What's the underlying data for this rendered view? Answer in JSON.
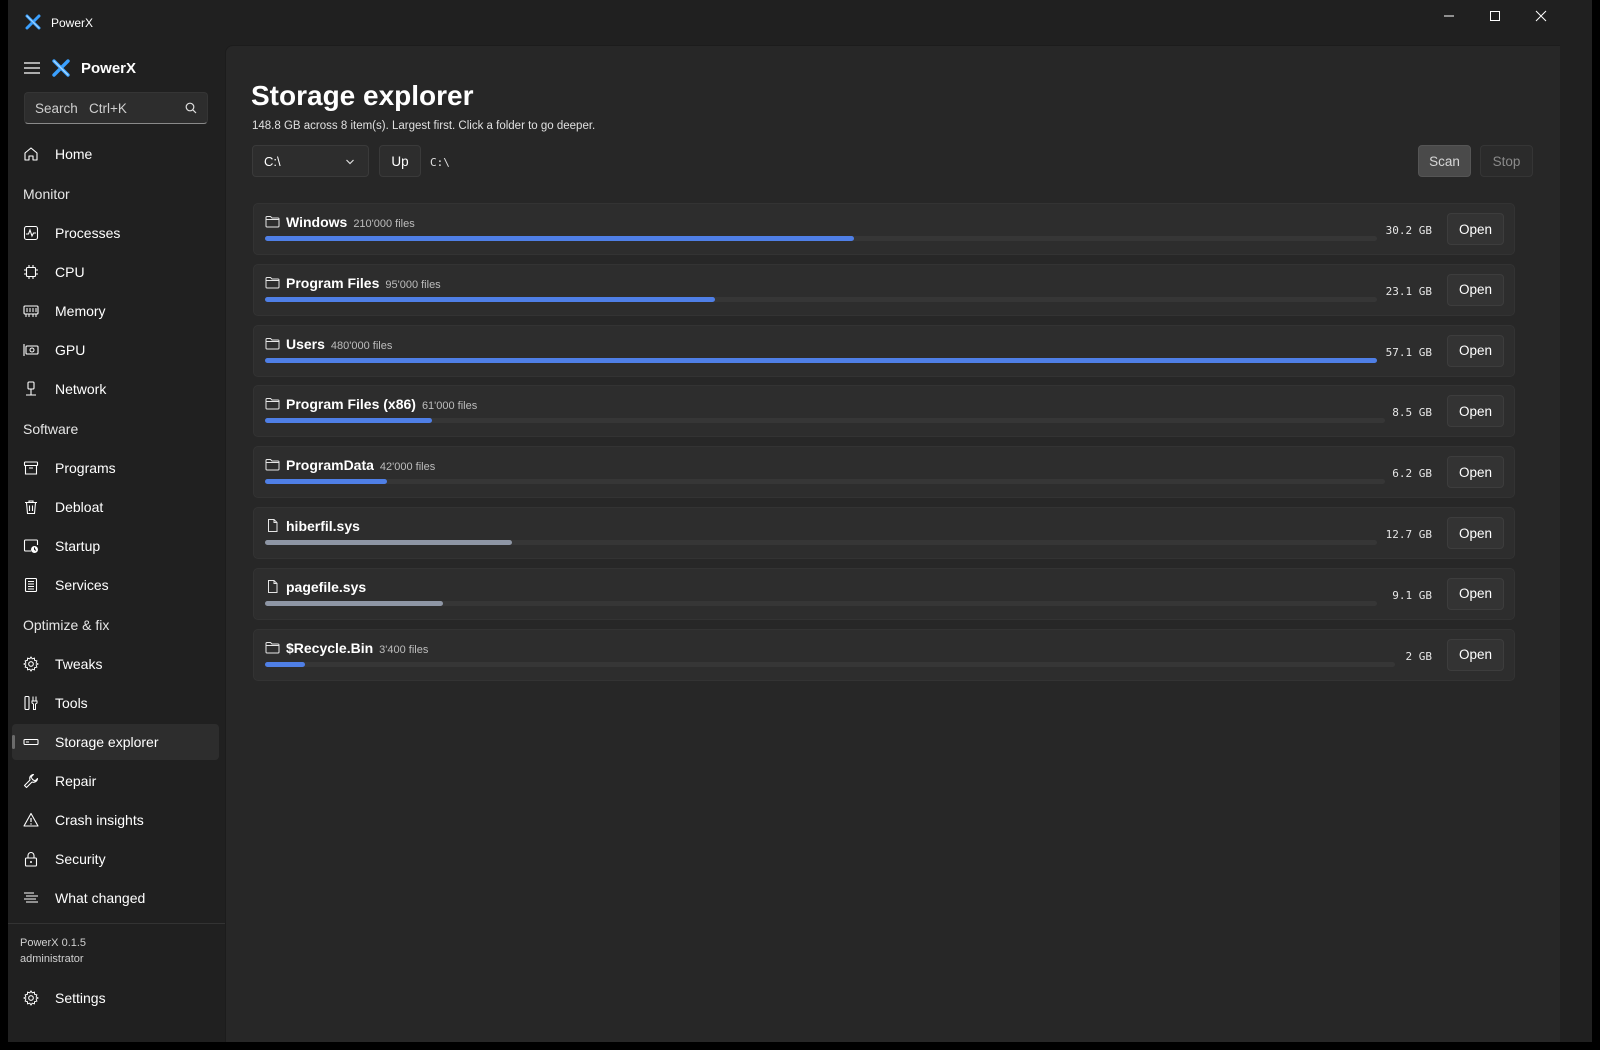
{
  "window": {
    "title": "PowerX"
  },
  "sidebar": {
    "brand": "PowerX",
    "search_placeholder": "Search   Ctrl+K",
    "items": [
      {
        "label": "Home",
        "icon": "home-icon"
      },
      {
        "section": "Monitor"
      },
      {
        "label": "Processes",
        "icon": "pulse-icon"
      },
      {
        "label": "CPU",
        "icon": "chip-icon"
      },
      {
        "label": "Memory",
        "icon": "memory-icon"
      },
      {
        "label": "GPU",
        "icon": "gpu-icon"
      },
      {
        "label": "Network",
        "icon": "network-icon"
      },
      {
        "section": "Software"
      },
      {
        "label": "Programs",
        "icon": "archive-icon"
      },
      {
        "label": "Debloat",
        "icon": "trash-icon"
      },
      {
        "label": "Startup",
        "icon": "startup-icon"
      },
      {
        "label": "Services",
        "icon": "services-icon"
      },
      {
        "section": "Optimize & fix"
      },
      {
        "label": "Tweaks",
        "icon": "gear-icon"
      },
      {
        "label": "Tools",
        "icon": "tools-icon"
      },
      {
        "label": "Storage explorer",
        "icon": "drive-icon",
        "active": true
      },
      {
        "label": "Repair",
        "icon": "wrench-icon"
      },
      {
        "label": "Crash insights",
        "icon": "warning-icon"
      },
      {
        "label": "Security",
        "icon": "lock-icon"
      },
      {
        "label": "What changed",
        "icon": "list-icon"
      }
    ],
    "version": "PowerX 0.1.5",
    "user": "administrator",
    "settings_label": "Settings"
  },
  "main": {
    "title": "Storage explorer",
    "subtitle": "148.8 GB across 8 item(s). Largest first. Click a folder to go deeper.",
    "drive": "C:\\",
    "up_label": "Up",
    "path": "C:\\",
    "scan_label": "Scan",
    "stop_label": "Stop",
    "open_label": "Open",
    "colors": {
      "folder_bar": "#4f7fe6",
      "file_bar": "#8e96a5"
    },
    "items": [
      {
        "name": "Windows",
        "files": "210'000 files",
        "size": "30.2 GB",
        "type": "folder",
        "fraction": 0.53
      },
      {
        "name": "Program Files",
        "files": "95'000 files",
        "size": "23.1 GB",
        "type": "folder",
        "fraction": 0.405
      },
      {
        "name": "Users",
        "files": "480'000 files",
        "size": "57.1 GB",
        "type": "folder",
        "fraction": 1.0
      },
      {
        "name": "Program Files (x86)",
        "files": "61'000 files",
        "size": "8.5 GB",
        "type": "folder",
        "fraction": 0.149
      },
      {
        "name": "ProgramData",
        "files": "42'000 files",
        "size": "6.2 GB",
        "type": "folder",
        "fraction": 0.109
      },
      {
        "name": "hiberfil.sys",
        "files": "",
        "size": "12.7 GB",
        "type": "file",
        "fraction": 0.222
      },
      {
        "name": "pagefile.sys",
        "files": "",
        "size": "9.1 GB",
        "type": "file",
        "fraction": 0.16
      },
      {
        "name": "$Recycle.Bin",
        "files": "3'400 files",
        "size": "2 GB",
        "type": "folder",
        "fraction": 0.035
      }
    ]
  }
}
